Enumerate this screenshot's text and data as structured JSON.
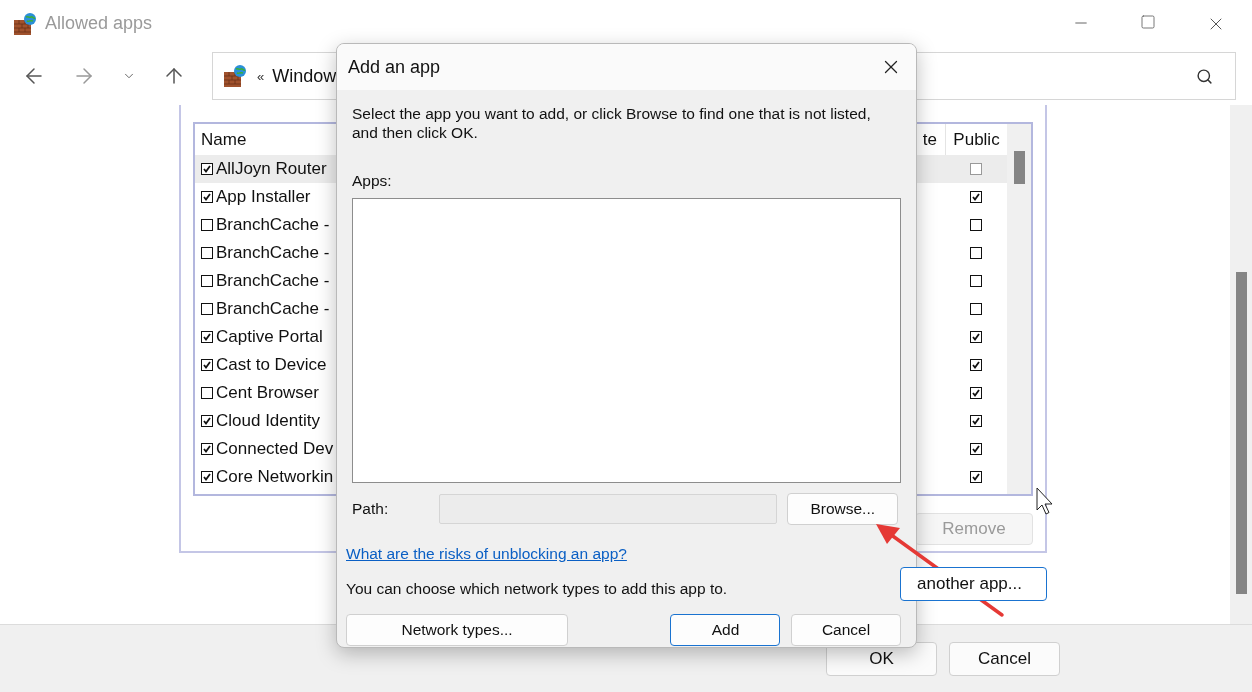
{
  "window": {
    "title": "Allowed apps"
  },
  "address_bar": {
    "separator": "«",
    "path": "Window"
  },
  "apps_list": {
    "columns": [
      "Name",
      "te",
      "Public"
    ],
    "rows": [
      {
        "name": "AllJoyn Router",
        "checked": true,
        "public": false,
        "selected": true
      },
      {
        "name": "App Installer",
        "checked": true,
        "public": true,
        "selected": false
      },
      {
        "name": "BranchCache -",
        "checked": false,
        "public": false,
        "selected": false
      },
      {
        "name": "BranchCache -",
        "checked": false,
        "public": false,
        "selected": false
      },
      {
        "name": "BranchCache -",
        "checked": false,
        "public": false,
        "selected": false
      },
      {
        "name": "BranchCache -",
        "checked": false,
        "public": false,
        "selected": false
      },
      {
        "name": "Captive Portal",
        "checked": true,
        "public": true,
        "selected": false
      },
      {
        "name": "Cast to Device",
        "checked": true,
        "public": true,
        "selected": false
      },
      {
        "name": "Cent Browser",
        "checked": false,
        "public": true,
        "selected": false
      },
      {
        "name": "Cloud Identity",
        "checked": true,
        "public": true,
        "selected": false
      },
      {
        "name": "Connected Dev",
        "checked": true,
        "public": true,
        "selected": false
      },
      {
        "name": "Core Networkin",
        "checked": true,
        "public": true,
        "selected": false
      }
    ]
  },
  "remove_button": {
    "label": "Remove",
    "disabled": true
  },
  "allow_another_button": {
    "label": "another app..."
  },
  "footer_buttons": [
    "OK",
    "Cancel"
  ],
  "dialog": {
    "title": "Add an app",
    "instructions": [
      "Select the app you want to add, or click Browse to find one that is not listed,",
      "and then click OK."
    ],
    "apps_label": "Apps:",
    "path_label": "Path:",
    "browse_button": "Browse...",
    "risks_link": "What are the risks of unblocking an app?",
    "network_note": "You can choose which network types to add this app to.",
    "network_types_button": "Network types...",
    "add_button": "Add",
    "cancel_button": "Cancel"
  }
}
